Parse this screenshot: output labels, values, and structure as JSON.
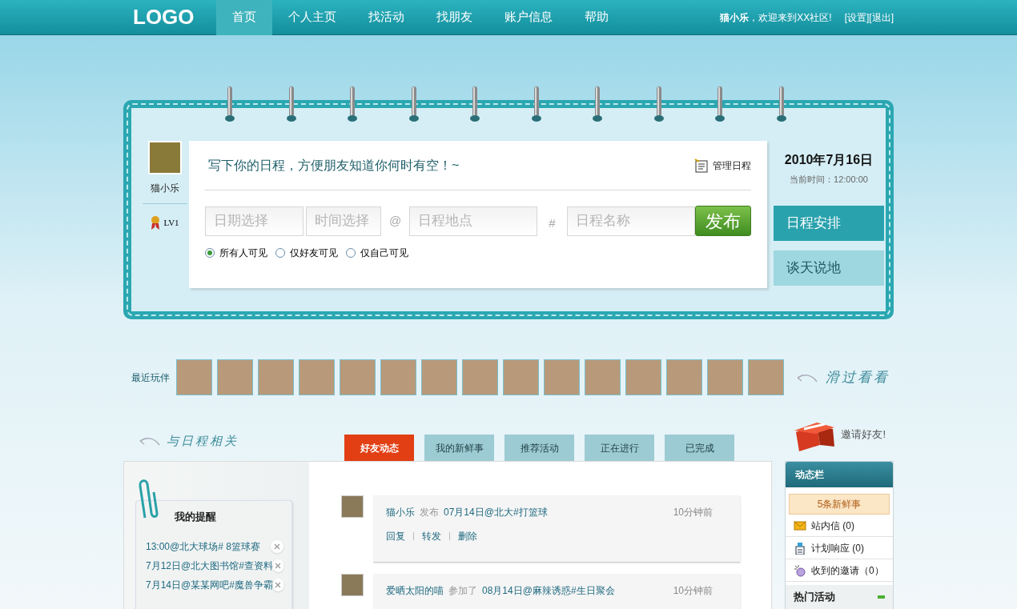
{
  "nav": {
    "logo": "LOGO",
    "items": [
      {
        "label": "首页",
        "selected": true
      },
      {
        "label": "个人主页",
        "selected": false
      },
      {
        "label": "找活动",
        "selected": false
      },
      {
        "label": "找朋友",
        "selected": false
      },
      {
        "label": "账户信息",
        "selected": false
      },
      {
        "label": "帮助",
        "selected": false
      }
    ],
    "greeting": "**猫小乐**，欢迎来到XX社区!",
    "links": [
      "[设置]",
      "[退出]"
    ]
  },
  "profile": {
    "name": "猫小乐",
    "level": "LV1"
  },
  "composer": {
    "prompt": "写下你的日程，方便朋友知道你何时有空！~",
    "manage": "管理日程",
    "fields": [
      {
        "placeholder": "日期选择",
        "kind": "short"
      },
      {
        "placeholder": "时间选择",
        "kind": "short",
        "sep": "@"
      },
      {
        "placeholder": "日程地点",
        "kind": "wide",
        "sep": "#"
      },
      {
        "placeholder": "日程名称",
        "kind": "wide"
      }
    ],
    "submit": "发布",
    "visibility": [
      {
        "label": "所有人可见",
        "selected": true
      },
      {
        "label": "仅好友可见",
        "selected": false
      },
      {
        "label": "仅自己可见",
        "selected": false
      }
    ]
  },
  "date": {
    "date": "2010年7月16日",
    "time": "当前时间：12:00:00"
  },
  "side_tabs": [
    {
      "label": "日程安排",
      "selected": true
    },
    {
      "label": "谈天说地",
      "selected": false
    }
  ],
  "recent": {
    "label": "最近玩伴",
    "avatars": [
      {
        "kind": "photo"
      },
      {
        "kind": "photo"
      },
      {
        "kind": "photo"
      },
      {
        "kind": "photo"
      },
      {
        "kind": "photo"
      },
      {
        "kind": "photo"
      },
      {
        "kind": "photo"
      },
      {
        "kind": "photo"
      },
      {
        "kind": "photo"
      },
      {
        "kind": "photo"
      },
      {
        "kind": "photo"
      },
      {
        "kind": "photo"
      },
      {
        "kind": "photo"
      },
      {
        "kind": "photo"
      },
      {
        "kind": "photo"
      }
    ],
    "hint": "滑过看看"
  },
  "section_title": "与日程相关",
  "tabs": [
    {
      "label": "好友动态",
      "selected": true
    },
    {
      "label": "我的新鲜事",
      "selected": false
    },
    {
      "label": "推荐活动",
      "selected": false
    },
    {
      "label": "正在进行",
      "selected": false
    },
    {
      "label": "已完成",
      "selected": false
    }
  ],
  "invite": "邀请好友!",
  "reminders": {
    "title": "我的提醒",
    "items": [
      "13:00@北大球场# 8篮球赛",
      "7月12日@北大图书馆#查资料",
      "7月14日@某某网吧#魔兽争霸"
    ]
  },
  "feed": [
    {
      "user": "猫小乐",
      "action": "发布",
      "event": "07月14日@北大#打篮球",
      "time": "10分钟前",
      "actions": [
        "回复",
        "转发",
        "删除"
      ]
    },
    {
      "user": "爱晒太阳的喵",
      "action": "参加了",
      "event": "08月14日@麻辣诱惑#生日聚会",
      "time": "10分钟前"
    }
  ],
  "dynamic": {
    "title": "动态栏",
    "badge": "5条新鲜事",
    "items": [
      {
        "label": "站内信 (0)",
        "kind": "mail"
      },
      {
        "label": "计划响应 (0)",
        "kind": "plan"
      },
      {
        "label": "收到的邀请（0）",
        "kind": "invite"
      }
    ],
    "hot": "热门活动",
    "hot_expanded": true
  }
}
